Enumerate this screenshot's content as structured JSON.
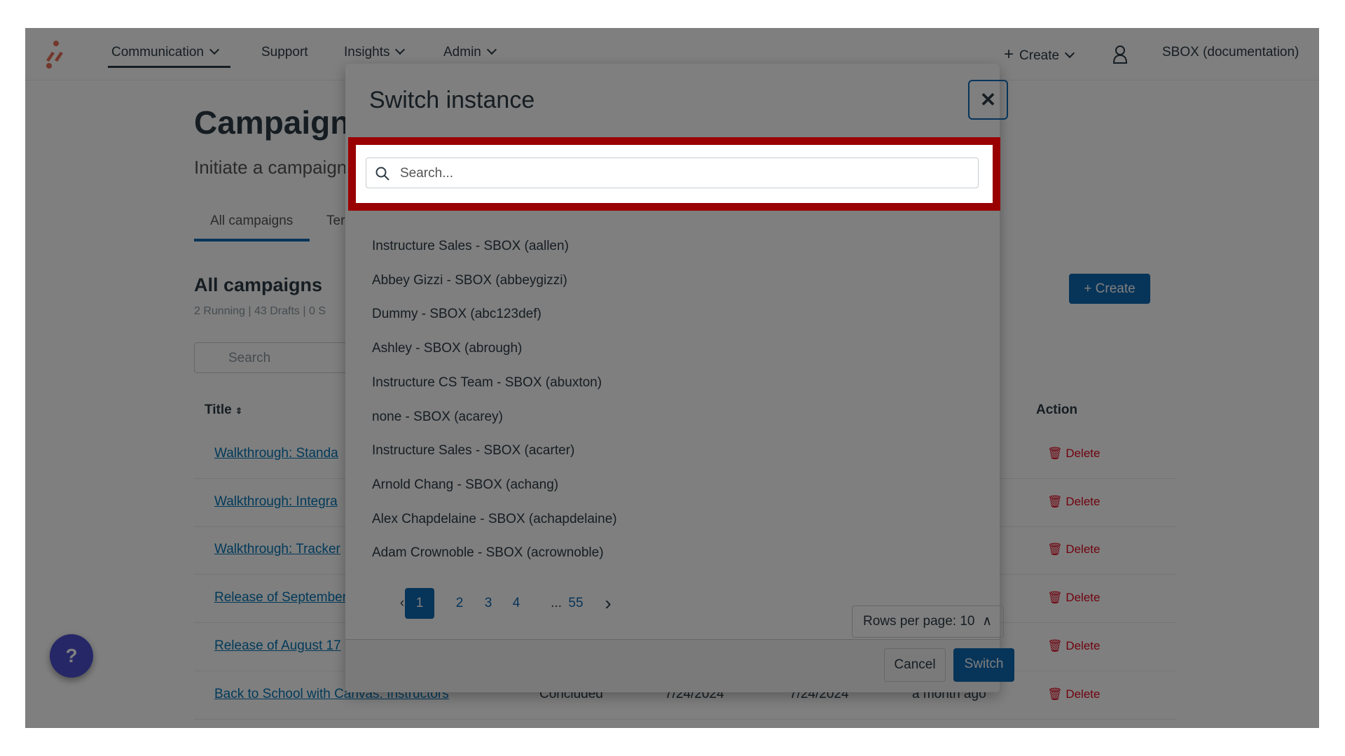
{
  "nav": {
    "items": [
      {
        "label": "Communication",
        "dropdown": true
      },
      {
        "label": "Support",
        "dropdown": false
      },
      {
        "label": "Insights",
        "dropdown": true
      },
      {
        "label": "Admin",
        "dropdown": true
      }
    ],
    "create_label": "Create",
    "instance_label": "SBOX (documentation)"
  },
  "page": {
    "title": "Campaigns",
    "subtitle": "Initiate a campaign",
    "tabs": [
      "All campaigns",
      "Ter"
    ],
    "section_title": "All campaigns",
    "stats": [
      "2 Running",
      "43 Drafts",
      "0 S"
    ],
    "search_placeholder": "Search",
    "create_label": "Create",
    "columns": {
      "title": "Title",
      "action": "Action"
    },
    "rows": [
      {
        "title": "Walkthrough: Standa",
        "action": "Delete"
      },
      {
        "title": "Walkthrough: Integra",
        "action": "Delete"
      },
      {
        "title": "Walkthrough: Tracker",
        "action": "Delete"
      },
      {
        "title": "Release of September",
        "action": "Delete"
      },
      {
        "title": "Release of August 17",
        "action": "Delete"
      },
      {
        "title": "Back to School with Canvas: Instructors",
        "status": "Concluded",
        "start": "7/24/2024",
        "end": "7/24/2024",
        "updated": "a month ago",
        "action": "Delete"
      }
    ]
  },
  "modal": {
    "title": "Switch instance",
    "search_placeholder": "Search...",
    "items": [
      "Instructure Sales - SBOX (aallen)",
      "Abbey Gizzi - SBOX (abbeygizzi)",
      "Dummy - SBOX (abc123def)",
      "Ashley - SBOX (abrough)",
      "Instructure CS Team - SBOX (abuxton)",
      "none - SBOX (acarey)",
      "Instructure Sales - SBOX (acarter)",
      "Arnold Chang - SBOX (achang)",
      "Alex Chapdelaine - SBOX (achapdelaine)",
      "Adam Crownoble - SBOX (acrownoble)"
    ],
    "pagination": {
      "pages": [
        "1",
        "2",
        "3",
        "4"
      ],
      "ellipsis": "...",
      "last": "55",
      "current": "1"
    },
    "rows_per_page": "Rows per page: 10",
    "cancel_label": "Cancel",
    "switch_label": "Switch"
  },
  "colors": {
    "highlight": "#990000",
    "primary": "#0e68b3",
    "danger": "#e0061f",
    "help": "#4b4fcf"
  }
}
